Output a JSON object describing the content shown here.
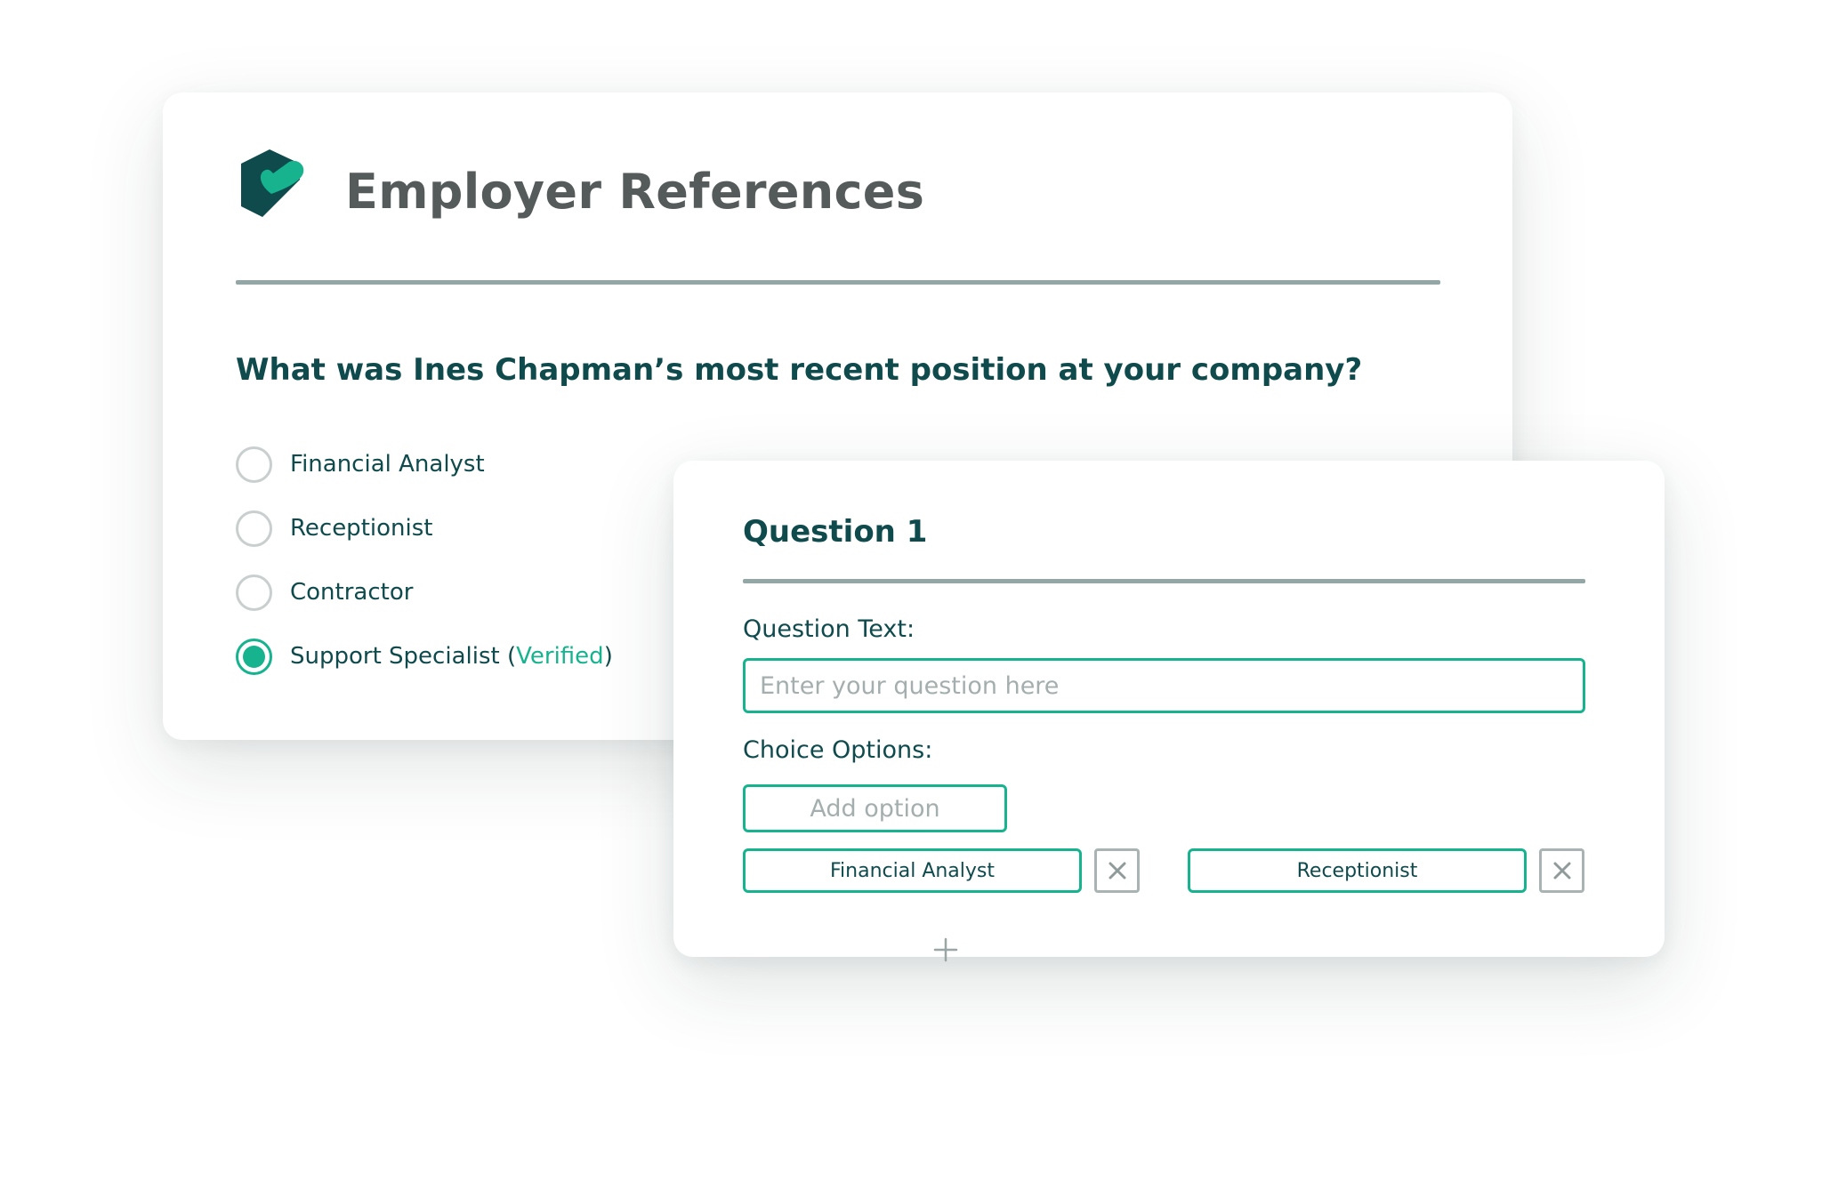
{
  "colors": {
    "accent": "#16b38e",
    "brand_dark": "#0f4a4d",
    "title_gray": "#555a5a",
    "divider": "#93a7a6",
    "placeholder": "#a4aeae"
  },
  "reference_form": {
    "logo_icon": "checkmark-hexagon-logo-icon",
    "title": "Employer References",
    "question": "What was Ines Chapman’s most recent position at your company?",
    "answers": [
      {
        "label": "Financial Analyst",
        "selected": false
      },
      {
        "label": "Receptionist",
        "selected": false
      },
      {
        "label": "Contractor",
        "selected": false
      },
      {
        "label": "Support Specialist",
        "selected": true,
        "open_paren": " (",
        "badge": "Verified",
        "close_paren": ")"
      }
    ]
  },
  "question_editor": {
    "title": "Question 1",
    "question_text_label": "Question Text:",
    "question_text_placeholder": "Enter your question here",
    "question_text_value": "",
    "choice_options_label": "Choice Options:",
    "add_option_placeholder": "Add option",
    "add_option_value": "",
    "options": [
      {
        "label": "Financial Analyst",
        "remove_icon": "close-icon"
      },
      {
        "label": "Receptionist",
        "remove_icon": "close-icon"
      }
    ],
    "add_choice_icon": "plus-icon"
  }
}
